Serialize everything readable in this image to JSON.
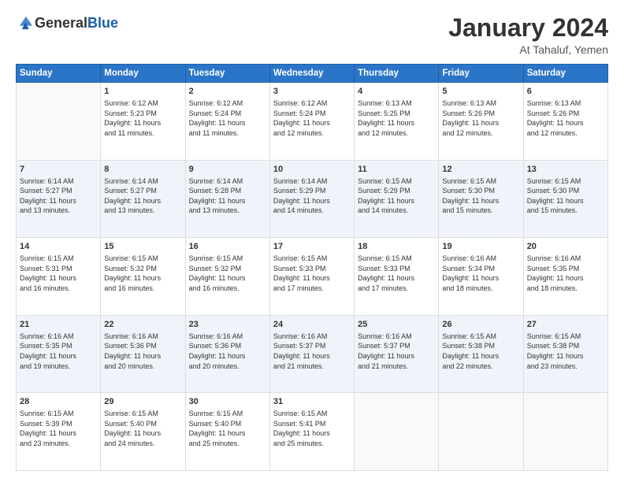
{
  "header": {
    "logo_general": "General",
    "logo_blue": "Blue",
    "month_title": "January 2024",
    "location": "At Tahaluf, Yemen"
  },
  "days_of_week": [
    "Sunday",
    "Monday",
    "Tuesday",
    "Wednesday",
    "Thursday",
    "Friday",
    "Saturday"
  ],
  "weeks": [
    [
      {
        "day": "",
        "info": ""
      },
      {
        "day": "1",
        "info": "Sunrise: 6:12 AM\nSunset: 5:23 PM\nDaylight: 11 hours\nand 11 minutes."
      },
      {
        "day": "2",
        "info": "Sunrise: 6:12 AM\nSunset: 5:24 PM\nDaylight: 11 hours\nand 11 minutes."
      },
      {
        "day": "3",
        "info": "Sunrise: 6:12 AM\nSunset: 5:24 PM\nDaylight: 11 hours\nand 12 minutes."
      },
      {
        "day": "4",
        "info": "Sunrise: 6:13 AM\nSunset: 5:25 PM\nDaylight: 11 hours\nand 12 minutes."
      },
      {
        "day": "5",
        "info": "Sunrise: 6:13 AM\nSunset: 5:26 PM\nDaylight: 11 hours\nand 12 minutes."
      },
      {
        "day": "6",
        "info": "Sunrise: 6:13 AM\nSunset: 5:26 PM\nDaylight: 11 hours\nand 12 minutes."
      }
    ],
    [
      {
        "day": "7",
        "info": "Sunrise: 6:14 AM\nSunset: 5:27 PM\nDaylight: 11 hours\nand 13 minutes."
      },
      {
        "day": "8",
        "info": "Sunrise: 6:14 AM\nSunset: 5:27 PM\nDaylight: 11 hours\nand 13 minutes."
      },
      {
        "day": "9",
        "info": "Sunrise: 6:14 AM\nSunset: 5:28 PM\nDaylight: 11 hours\nand 13 minutes."
      },
      {
        "day": "10",
        "info": "Sunrise: 6:14 AM\nSunset: 5:29 PM\nDaylight: 11 hours\nand 14 minutes."
      },
      {
        "day": "11",
        "info": "Sunrise: 6:15 AM\nSunset: 5:29 PM\nDaylight: 11 hours\nand 14 minutes."
      },
      {
        "day": "12",
        "info": "Sunrise: 6:15 AM\nSunset: 5:30 PM\nDaylight: 11 hours\nand 15 minutes."
      },
      {
        "day": "13",
        "info": "Sunrise: 6:15 AM\nSunset: 5:30 PM\nDaylight: 11 hours\nand 15 minutes."
      }
    ],
    [
      {
        "day": "14",
        "info": "Sunrise: 6:15 AM\nSunset: 5:31 PM\nDaylight: 11 hours\nand 16 minutes."
      },
      {
        "day": "15",
        "info": "Sunrise: 6:15 AM\nSunset: 5:32 PM\nDaylight: 11 hours\nand 16 minutes."
      },
      {
        "day": "16",
        "info": "Sunrise: 6:15 AM\nSunset: 5:32 PM\nDaylight: 11 hours\nand 16 minutes."
      },
      {
        "day": "17",
        "info": "Sunrise: 6:15 AM\nSunset: 5:33 PM\nDaylight: 11 hours\nand 17 minutes."
      },
      {
        "day": "18",
        "info": "Sunrise: 6:15 AM\nSunset: 5:33 PM\nDaylight: 11 hours\nand 17 minutes."
      },
      {
        "day": "19",
        "info": "Sunrise: 6:16 AM\nSunset: 5:34 PM\nDaylight: 11 hours\nand 18 minutes."
      },
      {
        "day": "20",
        "info": "Sunrise: 6:16 AM\nSunset: 5:35 PM\nDaylight: 11 hours\nand 18 minutes."
      }
    ],
    [
      {
        "day": "21",
        "info": "Sunrise: 6:16 AM\nSunset: 5:35 PM\nDaylight: 11 hours\nand 19 minutes."
      },
      {
        "day": "22",
        "info": "Sunrise: 6:16 AM\nSunset: 5:36 PM\nDaylight: 11 hours\nand 20 minutes."
      },
      {
        "day": "23",
        "info": "Sunrise: 6:16 AM\nSunset: 5:36 PM\nDaylight: 11 hours\nand 20 minutes."
      },
      {
        "day": "24",
        "info": "Sunrise: 6:16 AM\nSunset: 5:37 PM\nDaylight: 11 hours\nand 21 minutes."
      },
      {
        "day": "25",
        "info": "Sunrise: 6:16 AM\nSunset: 5:37 PM\nDaylight: 11 hours\nand 21 minutes."
      },
      {
        "day": "26",
        "info": "Sunrise: 6:15 AM\nSunset: 5:38 PM\nDaylight: 11 hours\nand 22 minutes."
      },
      {
        "day": "27",
        "info": "Sunrise: 6:15 AM\nSunset: 5:38 PM\nDaylight: 11 hours\nand 23 minutes."
      }
    ],
    [
      {
        "day": "28",
        "info": "Sunrise: 6:15 AM\nSunset: 5:39 PM\nDaylight: 11 hours\nand 23 minutes."
      },
      {
        "day": "29",
        "info": "Sunrise: 6:15 AM\nSunset: 5:40 PM\nDaylight: 11 hours\nand 24 minutes."
      },
      {
        "day": "30",
        "info": "Sunrise: 6:15 AM\nSunset: 5:40 PM\nDaylight: 11 hours\nand 25 minutes."
      },
      {
        "day": "31",
        "info": "Sunrise: 6:15 AM\nSunset: 5:41 PM\nDaylight: 11 hours\nand 25 minutes."
      },
      {
        "day": "",
        "info": ""
      },
      {
        "day": "",
        "info": ""
      },
      {
        "day": "",
        "info": ""
      }
    ]
  ]
}
